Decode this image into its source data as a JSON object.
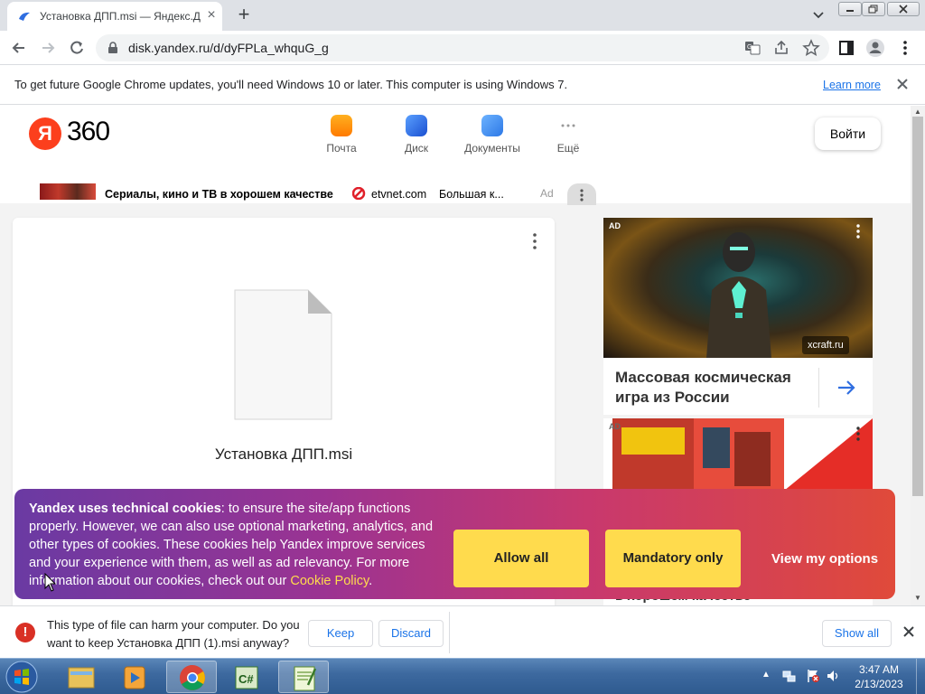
{
  "browser": {
    "tab_title": "Установка ДПП.msi — Яндекс.Д",
    "url": "disk.yandex.ru/d/dyFPLa_whquG_g"
  },
  "infobar": {
    "message": "To get future Google Chrome updates, you'll need Windows 10 or later. This computer is using Windows 7.",
    "link": "Learn more"
  },
  "header": {
    "logo_letter": "Я",
    "logo_text": "360",
    "services": [
      {
        "label": "Почта",
        "icon": "mail-icon",
        "color": "#ff9500"
      },
      {
        "label": "Диск",
        "icon": "disk-icon",
        "color": "#2f6ee0"
      },
      {
        "label": "Документы",
        "icon": "documents-icon",
        "color": "#3b8be8"
      },
      {
        "label": "Ещё",
        "icon": "more-dots-icon",
        "color": "#999999"
      }
    ],
    "login_label": "Войти"
  },
  "ad_strip": {
    "title": "Сериалы, кино и ТВ в хорошем качестве",
    "domain": "etvnet.com",
    "description": "Большая к...",
    "label": "Ad"
  },
  "file": {
    "name": "Установка ДПП.msi"
  },
  "side_ads": [
    {
      "tag": "AD",
      "source": "xcraft.ru",
      "title": "Массовая космическая игра из России"
    },
    {
      "tag": "AD",
      "text": "в хорошем качестве"
    }
  ],
  "cookie_banner": {
    "bold": "Yandex uses technical cookies",
    "text": ": to ensure the site/app functions properly. However, we can also use optional marketing, analytics, and other types of cookies. These cookies help Yandex improve services and your experience with them, as well as ad relevancy. For more information about our cookies, check out our ",
    "link": "Cookie Policy",
    "after_link": ".",
    "allow_all": "Allow all",
    "mandatory_only": "Mandatory only",
    "view_options": "View my options",
    "gradient_start": "#6a3aa3",
    "gradient_end": "#e04a3a",
    "button_color": "#ffdb4d"
  },
  "download_shelf": {
    "warning": "This type of file can harm your computer. Do you want to keep Установка ДПП (1).msi anyway?",
    "keep": "Keep",
    "discard": "Discard",
    "show_all": "Show all"
  },
  "taskbar": {
    "time": "3:47 AM",
    "date": "2/13/2023",
    "apps": [
      "windows-explorer-icon",
      "media-player-icon",
      "chrome-icon",
      "csharp-icon",
      "notepad-plus-plus-icon"
    ],
    "active_app": "chrome-icon"
  }
}
